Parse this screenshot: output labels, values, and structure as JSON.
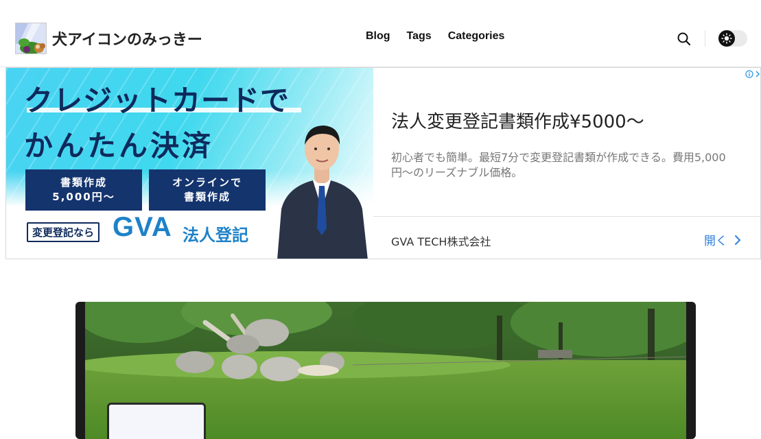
{
  "site": {
    "title": "犬アイコンのみっきー"
  },
  "nav": {
    "items": [
      "Blog",
      "Tags",
      "Categories"
    ]
  },
  "header_icons": {
    "search": "search-icon",
    "theme": "sun-icon"
  },
  "ad": {
    "creative": {
      "headline_line1": "クレジットカードで",
      "headline_line2": "かんたん決済",
      "box1": "書類作成\n5,000円〜",
      "box2": "オンラインで\n書類作成",
      "footer_label": "変更登記なら",
      "brand": "GVA",
      "brand_sub": "法人登記"
    },
    "title": "法人変更登記書類作成¥5000〜",
    "description": "初心者でも簡単。最短7分で変更登記書類が作成できる。費用5,000円〜のリーズナブル価格。",
    "advertiser": "GVA TECH株式会社",
    "open_label": "開く",
    "choices_icon": "info-icon",
    "colors": {
      "cyan": "#49d3f2",
      "navy": "#14346e",
      "brand_blue": "#1e82c8",
      "link_blue": "#2f7fdc"
    }
  }
}
